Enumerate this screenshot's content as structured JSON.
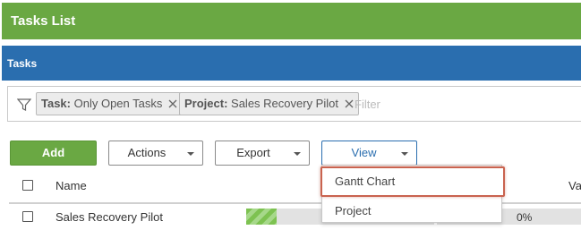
{
  "header": {
    "title": "Tasks List"
  },
  "panel": {
    "title": "Tasks"
  },
  "filters": {
    "chips": [
      {
        "key": "Task:",
        "value": "Only Open Tasks"
      },
      {
        "key": "Project:",
        "value": "Sales Recovery Pilot"
      }
    ],
    "placeholder": "Filter"
  },
  "toolbar": {
    "add_label": "Add",
    "actions_label": "Actions",
    "export_label": "Export",
    "view_label": "View"
  },
  "view_menu": {
    "items": [
      "Gantt Chart",
      "Project"
    ],
    "highlighted": "Gantt Chart"
  },
  "table": {
    "columns": [
      "Name",
      "Va"
    ],
    "rows": [
      {
        "name": "Sales Recovery Pilot",
        "progress_fraction": 0.16,
        "value_percent": "0%",
        "value_fraction": 0
      }
    ]
  },
  "colors": {
    "green": "#6aa843",
    "blue": "#2a6eaf",
    "highlight": "#c9634f"
  }
}
